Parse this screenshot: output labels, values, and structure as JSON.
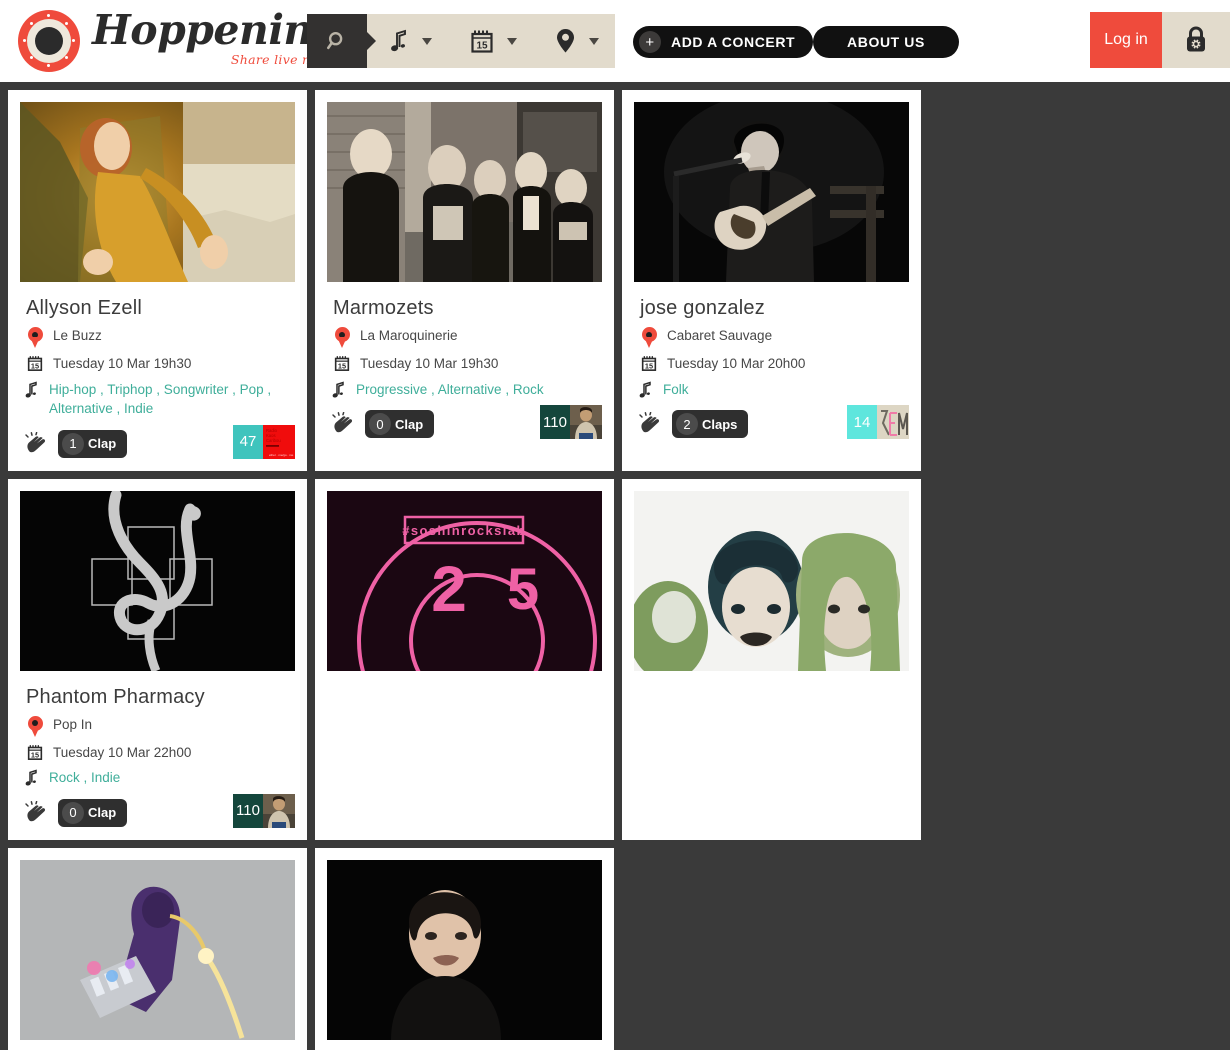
{
  "brand": {
    "name": "Hoppening",
    "tagline": "Share live music",
    "logo_icon": "vinyl-record-icon",
    "accent_color": "#ef4b3c"
  },
  "header": {
    "search": {
      "search_icon": "search-icon",
      "filters": [
        {
          "icon": "music-note-icon",
          "name": "genre-filter"
        },
        {
          "icon": "calendar-icon",
          "name": "date-filter",
          "day": "15"
        },
        {
          "icon": "map-pin-icon",
          "name": "location-filter"
        }
      ]
    },
    "add_concert_label": "ADD A CONCERT",
    "add_concert_icon": "plus-icon",
    "about_us_label": "ABOUT US",
    "login_label": "Log in",
    "lock_icon": "padlock-icon"
  },
  "cards": [
    {
      "title": "Allyson Ezell",
      "venue": "Le Buzz",
      "date": "Tuesday 10 Mar 19h30",
      "genres": "Hip-hop , Triphop , Songwriter , Pop , Alternative , Indie",
      "clap_count": "1",
      "clap_label": "Clap",
      "attendees": "47",
      "attendee_bg": "#3fc4bd",
      "image_alt": "woman-in-gold-sequin-dress"
    },
    {
      "title": "Marmozets",
      "venue": "La Maroquinerie",
      "date": "Tuesday 10 Mar 19h30",
      "genres": "Progressive , Alternative , Rock",
      "clap_count": "0",
      "clap_label": "Clap",
      "attendees": "110",
      "attendee_bg": "#14463c",
      "image_alt": "band-in-alley-black-and-white"
    },
    {
      "title": "jose gonzalez",
      "venue": "Cabaret Sauvage",
      "date": "Tuesday 10 Mar 20h00",
      "genres": "Folk",
      "clap_count": "2",
      "clap_label": "Claps",
      "attendees": "14",
      "attendee_bg": "#5ee6dd",
      "image_alt": "man-playing-guitar-on-stage"
    },
    {
      "title": "Phantom Pharmacy",
      "venue": "Pop In",
      "date": "Tuesday 10 Mar 22h00",
      "genres": "Rock , Indie",
      "clap_count": "0",
      "clap_label": "Clap",
      "attendees": "110",
      "attendee_bg": "#14463c",
      "image_alt": "pharmacy-cross-snake-logo"
    }
  ],
  "cards_row2": [
    {
      "image_alt": "soshinrockslab-poster",
      "poster_text": "#soshinrockslab"
    },
    {
      "image_alt": "three-people-green-hair"
    },
    {
      "image_alt": "keytar-performer-on-stage"
    },
    {
      "image_alt": "portrait-woman-dark-background"
    }
  ]
}
